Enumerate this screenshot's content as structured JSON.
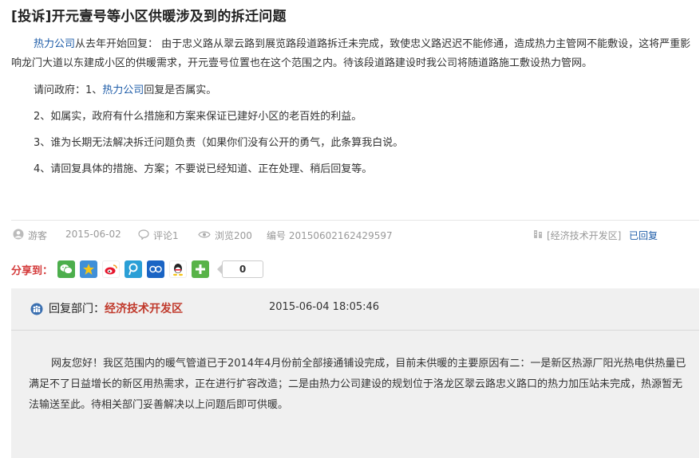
{
  "title": "[投诉]开元壹号等小区供暖涉及到的拆迁问题",
  "complaint": {
    "p1_link": "热力公司",
    "p1_text": "从去年开始回复： 由于忠义路从翠云路到展览路段道路拆迁未完成，致使忠义路迟迟不能修通，造成热力主管网不能敷设，这将严重影响龙门大道以东建成小区的供暖需求，开元壹号位置也在这个范围之内。待该段道路建设时我公司将随道路施工敷设热力管网。",
    "p2_prefix": "请问政府：1、",
    "p2_link": "热力公司",
    "p2_text": "回复是否属实。",
    "p3": "2、如属实，政府有什么措施和方案来保证已建好小区的老百姓的利益。",
    "p4": "3、谁为长期无法解决拆迁问题负责（如果你们没有公开的勇气，此条算我白说。",
    "p5": "4、请回复具体的措施、方案；不要说已经知道、正在处理、稍后回复等。"
  },
  "meta": {
    "user": "游客",
    "date": "2015-06-02",
    "comments": "评论1",
    "views": "浏览200",
    "serial": "编号 20150602162429597",
    "department": "[经济技术开发区]",
    "status": "已回复"
  },
  "share": {
    "label": "分享到：",
    "count": "0",
    "icons": [
      "wechat-icon",
      "qzone-icon",
      "weibo-icon",
      "tencent-weibo-icon",
      "renren-icon",
      "qq-icon",
      "more-icon"
    ]
  },
  "reply": {
    "label_prefix": "回复部门：",
    "department": "经济技术开发区",
    "datetime": "2015-06-04 18:05:46",
    "body": "网友您好！我区范围内的暖气管道已于2014年4月份前全部接通铺设完成，目前未供暖的主要原因有二：一是新区热源厂阳光热电供热量已满足不了日益增长的新区用热需求，正在进行扩容改造；二是由热力公司建设的规划位于洛龙区翠云路忠义路口的热力加压站未完成，热源暂无法输送至此。待相关部门妥善解决以上问题后即可供暖。"
  },
  "colors": {
    "link": "#1e5ca8",
    "accent_red": "#c0392b",
    "reply_bg": "#f0f0f0"
  }
}
